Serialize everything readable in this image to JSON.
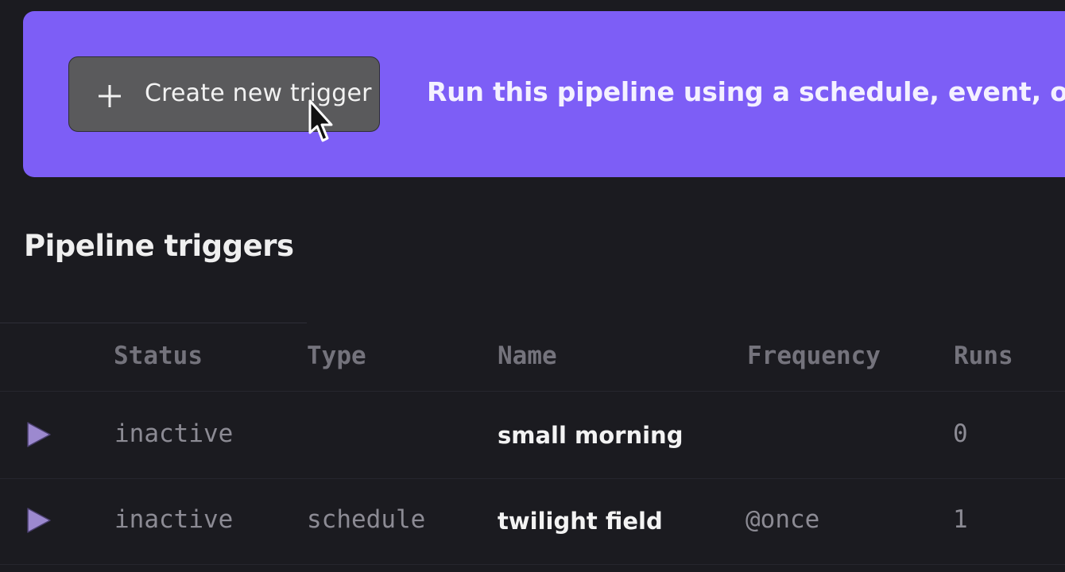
{
  "banner": {
    "create_button_label": "Create new trigger",
    "description": "Run this pipeline using a schedule, event, or API."
  },
  "section": {
    "title": "Pipeline triggers"
  },
  "table": {
    "headers": {
      "status": "Status",
      "type": "Type",
      "name": "Name",
      "frequency": "Frequency",
      "runs": "Runs"
    },
    "rows": [
      {
        "status": "inactive",
        "type": "",
        "name": "small morning",
        "frequency": "",
        "runs": "0"
      },
      {
        "status": "inactive",
        "type": "schedule",
        "name": "twilight field",
        "frequency": "@once",
        "runs": "1"
      }
    ]
  },
  "icons": {
    "plus": "plus-icon",
    "cursor": "mouse-pointer-icon",
    "play": "play-icon"
  },
  "colors": {
    "background": "#1b1b20",
    "banner": "#7d5ef6",
    "button": "#5a5a5c",
    "play": "#9c89cf"
  }
}
